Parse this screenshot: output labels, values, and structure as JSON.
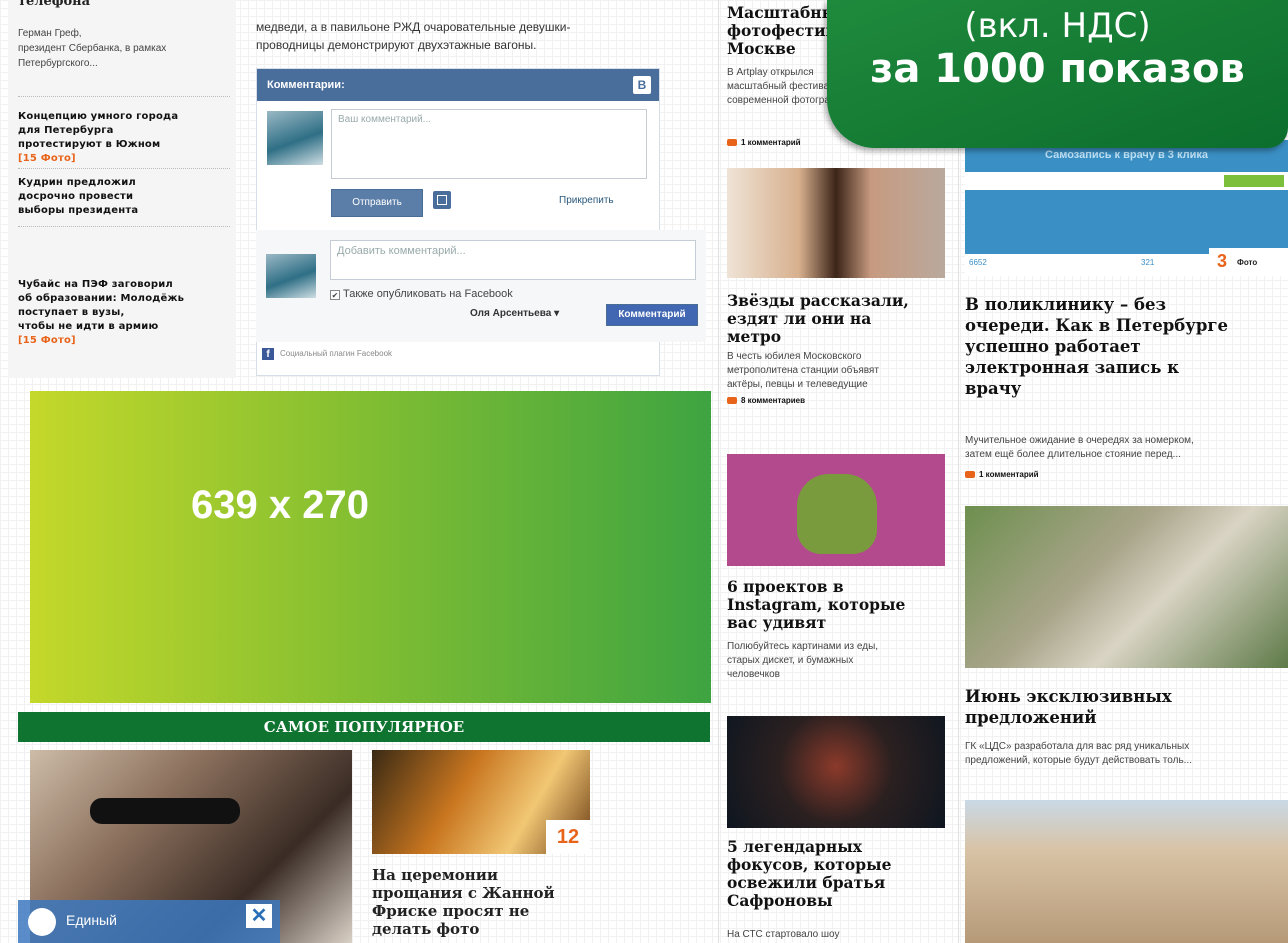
{
  "colors": {
    "accent_orange": "#e8641b",
    "green_dark": "#107431",
    "vk_blue": "#4a6e9c"
  },
  "left_column": {
    "top_partial_title": "телефона",
    "intro_text": [
      "Герман Греф,",
      "президент Сбербанка, в рамках",
      "Петербургского..."
    ],
    "news": [
      {
        "text": [
          "Концепцию умного города",
          "для Петербурга",
          "протестируют в Южном"
        ],
        "tag": "[15 Фото]"
      },
      {
        "text": [
          "Кудрин предложил",
          "досрочно провести",
          "выборы президента"
        ],
        "tag": ""
      },
      {
        "text": [
          "Чубайс на ПЭФ заговорил",
          "об образовании: Молодёжь",
          "поступает в вузы,",
          "чтобы не идти в армию"
        ],
        "tag": "[15 Фото]"
      }
    ]
  },
  "article": {
    "text_line1": "медведи, а в павильоне РЖД очаровательные девушки-",
    "text_line2": "проводницы демонстрируют двухэтажные вагоны."
  },
  "vk_widget": {
    "header": "Комментарии:",
    "logo": "B",
    "comment_placeholder": "Ваш комментарий...",
    "send_button": "Отправить",
    "attach_label": "Прикрепить"
  },
  "fb_widget": {
    "add_placeholder": "Добавить комментарий...",
    "also_post": "Также опубликовать на Facebook",
    "user_name": "Оля Арсентьева",
    "comment_button": "Комментарий",
    "plugin_label": "Социальный плагин Facebook"
  },
  "ad": {
    "size_label": "639 x 270"
  },
  "popular": {
    "header": "САМОЕ ПОПУЛЯРНОЕ",
    "photo_count": "12",
    "story_title": [
      "На церемонии",
      "прощания с Жанной",
      "Фриске просят не",
      "делать фото"
    ],
    "overlay_label": "Единый"
  },
  "middle_column": {
    "top_title": [
      "Масштабный",
      "фотофестиваль",
      "Москве"
    ],
    "top_desc": [
      "В Artplay открылся",
      "масштабный фестиваль",
      "современной фотографии"
    ],
    "top_comments": "1 комментарий",
    "items": [
      {
        "title": [
          "Звёзды рассказали,",
          "ездят ли они на",
          "метро"
        ],
        "desc": [
          "В честь юбилея Московского",
          "метрополитена станции объявят",
          "актёры, певцы и телеведущие"
        ],
        "comments": "8 комментариев"
      },
      {
        "title": [
          "6 проектов в",
          "Instagram, которые",
          "вас удивят"
        ],
        "desc": [
          "Полюбуйтесь картинами из еды,",
          "старых дискет, и бумажных",
          "человечков"
        ],
        "comments": ""
      },
      {
        "title": [
          "5 легендарных",
          "фокусов, которые",
          "освежили братья",
          "Сафроновы"
        ],
        "desc": [
          "На СТС стартовало шоу"
        ],
        "comments": ""
      }
    ]
  },
  "right_column": {
    "banner_text": "Самозапись к врачу в 3 клика",
    "photo_count": "3",
    "photo_word": "Фото",
    "stats": [
      "6652",
      "321"
    ],
    "items": [
      {
        "title": [
          "В поликлинику – без",
          "очереди. Как в Петербурге",
          "успешно работает",
          "электронная запись к",
          "врачу"
        ],
        "desc": [
          "Мучительное ожидание в очередях за номерком,",
          "затем ещё более длительное стояние перед..."
        ],
        "comments": "1 комментарий"
      },
      {
        "title": [
          "Июнь эксклюзивных",
          "предложений"
        ],
        "desc": [
          "ГК «ЦДС» разработала для вас ряд уникальных",
          "предложений, которые будут действовать толь..."
        ],
        "comments": ""
      }
    ]
  },
  "price_badge": {
    "line1": "(вкл. НДС)",
    "line2": "за 1000 показов"
  }
}
